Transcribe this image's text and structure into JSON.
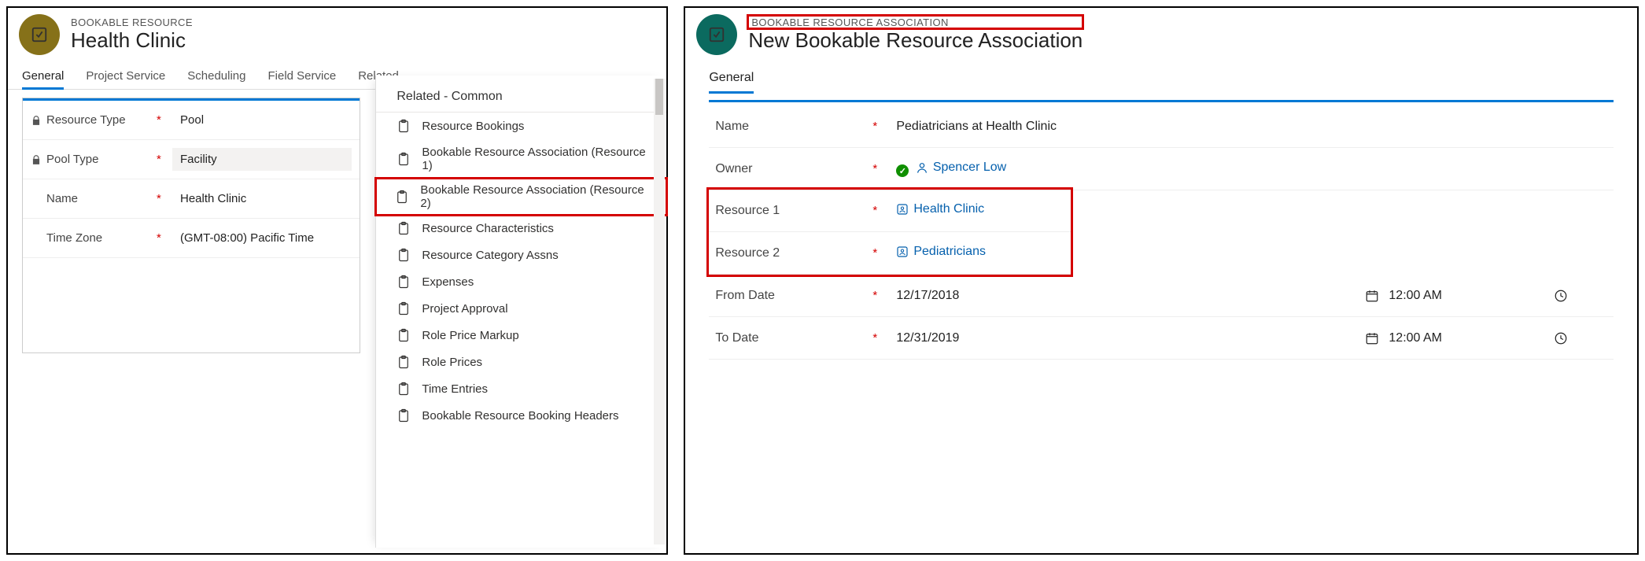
{
  "left": {
    "entity_label": "BOOKABLE RESOURCE",
    "title": "Health Clinic",
    "tabs": [
      "General",
      "Project Service",
      "Scheduling",
      "Field Service",
      "Related"
    ],
    "fields": {
      "resource_type": {
        "label": "Resource Type",
        "value": "Pool",
        "locked": true,
        "required": true
      },
      "pool_type": {
        "label": "Pool Type",
        "value": "Facility",
        "locked": true,
        "required": true
      },
      "name": {
        "label": "Name",
        "value": "Health Clinic",
        "required": true
      },
      "time_zone": {
        "label": "Time Zone",
        "value": "(GMT-08:00) Pacific Time",
        "required": true
      }
    },
    "related_title": "Related - Common",
    "related_items": [
      "Resource Bookings",
      "Bookable Resource Association (Resource 1)",
      "Bookable Resource Association (Resource 2)",
      "Resource Characteristics",
      "Resource Category Assns",
      "Expenses",
      "Project Approval",
      "Role Price Markup",
      "Role Prices",
      "Time Entries",
      "Bookable Resource Booking Headers"
    ],
    "related_highlight_index": 2
  },
  "right": {
    "entity_label": "BOOKABLE RESOURCE ASSOCIATION",
    "title": "New Bookable Resource Association",
    "tab": "General",
    "fields": {
      "name": {
        "label": "Name",
        "value": "Pediatricians at Health Clinic",
        "required": true
      },
      "owner": {
        "label": "Owner",
        "value": "Spencer Low",
        "required": true
      },
      "resource1": {
        "label": "Resource 1",
        "value": "Health Clinic",
        "required": true
      },
      "resource2": {
        "label": "Resource 2",
        "value": "Pediatricians",
        "required": true
      },
      "from_date": {
        "label": "From Date",
        "date": "12/17/2018",
        "time": "12:00 AM",
        "required": true
      },
      "to_date": {
        "label": "To Date",
        "date": "12/31/2019",
        "time": "12:00 AM",
        "required": true
      }
    }
  }
}
